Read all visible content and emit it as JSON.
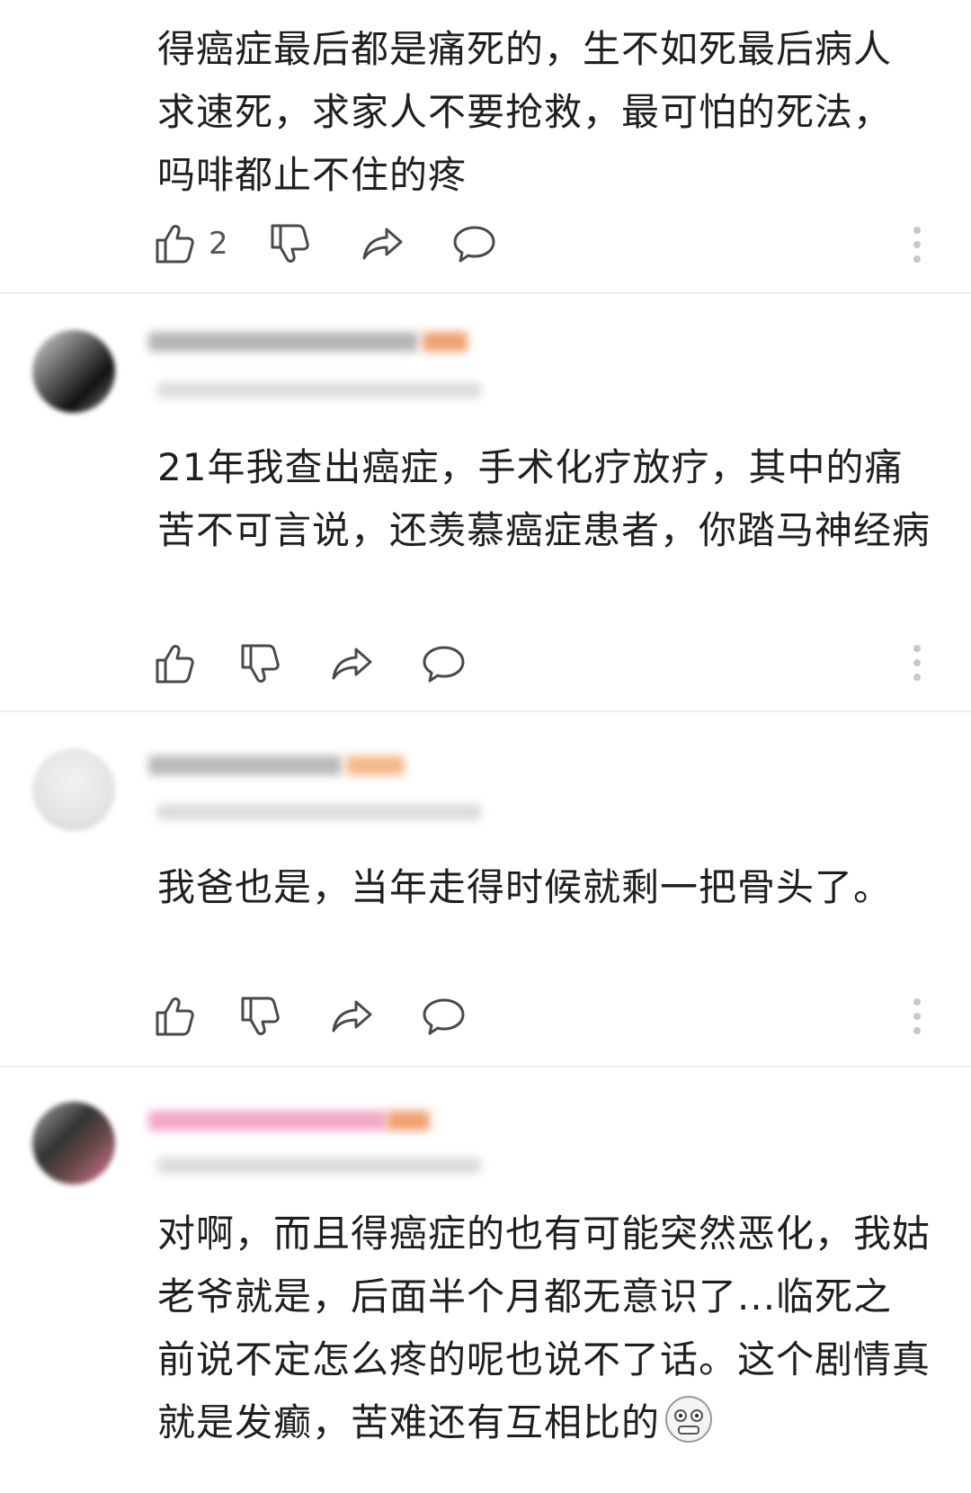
{
  "comments": [
    {
      "text": "得癌症最后都是痛死的，生不如死最后病人求速死，求家人不要抢救，最可怕的死法，吗啡都止不住的疼",
      "like_count": "2"
    },
    {
      "text": "21年我查出癌症，手术化疗放疗，其中的痛苦不可言说，还羡慕癌症患者，你踏马神经病"
    },
    {
      "text": "我爸也是，当年走得时候就剩一把骨头了。"
    },
    {
      "text": "对啊，而且得癌症的也有可能突然恶化，我姑老爷就是，后面半个月都无意识了...临死之前说不定怎么疼的呢也说不了话。这个剧情真就是发癫，苦难还有互相比的",
      "trailing_emoji": "grimacing-face-emoji"
    }
  ],
  "icons": {
    "like": "thumbs-up-icon",
    "dislike": "thumbs-down-icon",
    "share": "share-arrow-icon",
    "reply": "speech-bubble-icon",
    "more": "more-vertical-icon"
  },
  "colors": {
    "text": "#1f1f1f",
    "icon": "#4a4a4a",
    "divider": "#ececec",
    "username_orange_badge": "#f0a070",
    "username_pink": "#f3a6c8"
  }
}
